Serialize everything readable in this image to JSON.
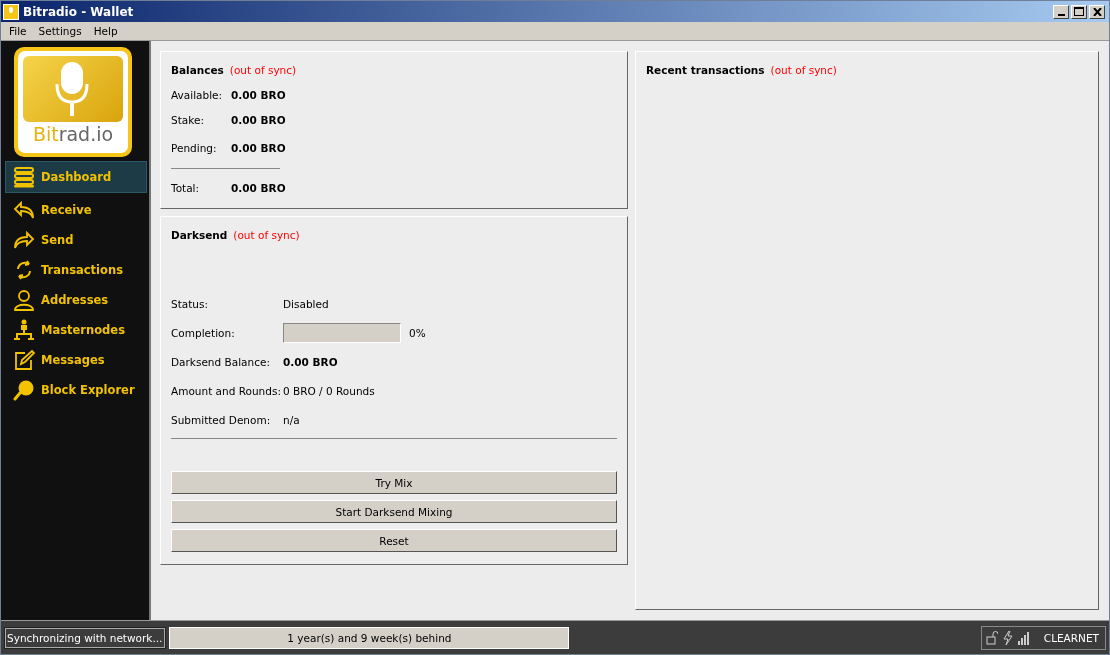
{
  "window": {
    "title": "Bitradio - Wallet"
  },
  "menu": [
    "File",
    "Settings",
    "Help"
  ],
  "logo": {
    "text_left": "Bit",
    "text_right": "rad.io"
  },
  "sidebar": {
    "items": [
      {
        "label": "Dashboard",
        "selected": true
      },
      {
        "label": "Receive",
        "selected": false
      },
      {
        "label": "Send",
        "selected": false
      },
      {
        "label": "Transactions",
        "selected": false
      },
      {
        "label": "Addresses",
        "selected": false
      },
      {
        "label": "Masternodes",
        "selected": false
      },
      {
        "label": "Messages",
        "selected": false
      },
      {
        "label": "Block Explorer",
        "selected": false
      }
    ]
  },
  "balances": {
    "title": "Balances",
    "sync_note": "(out of sync)",
    "rows": [
      {
        "label": "Available:",
        "value": "0.00 BRO"
      },
      {
        "label": "Stake:",
        "value": "0.00 BRO"
      },
      {
        "label": "Pending:",
        "value": "0.00 BRO"
      }
    ],
    "total": {
      "label": "Total:",
      "value": "0.00 BRO"
    }
  },
  "darksend": {
    "title": "Darksend",
    "sync_note": "(out of sync)",
    "rows": [
      {
        "kind": "text",
        "label": "Status:",
        "value": "Disabled"
      },
      {
        "kind": "progress",
        "label": "Completion:",
        "level": 0,
        "value": "0%"
      },
      {
        "kind": "bold",
        "label": "Darksend Balance:",
        "value": "0.00 BRO"
      },
      {
        "kind": "text",
        "label": "Amount and Rounds:",
        "value": "0 BRO / 0 Rounds"
      },
      {
        "kind": "text",
        "label": "Submitted Denom:",
        "value": "n/a"
      }
    ],
    "buttons": [
      "Try Mix",
      "Start Darksend Mixing",
      "Reset"
    ]
  },
  "recent_transactions": {
    "title": "Recent transactions",
    "sync_note": "(out of sync)"
  },
  "status_bar": {
    "message": "Synchronizing with network...",
    "progress": {
      "text": "1 year(s) and 9 week(s) behind",
      "level": 0
    },
    "network": "CLEARNET"
  }
}
